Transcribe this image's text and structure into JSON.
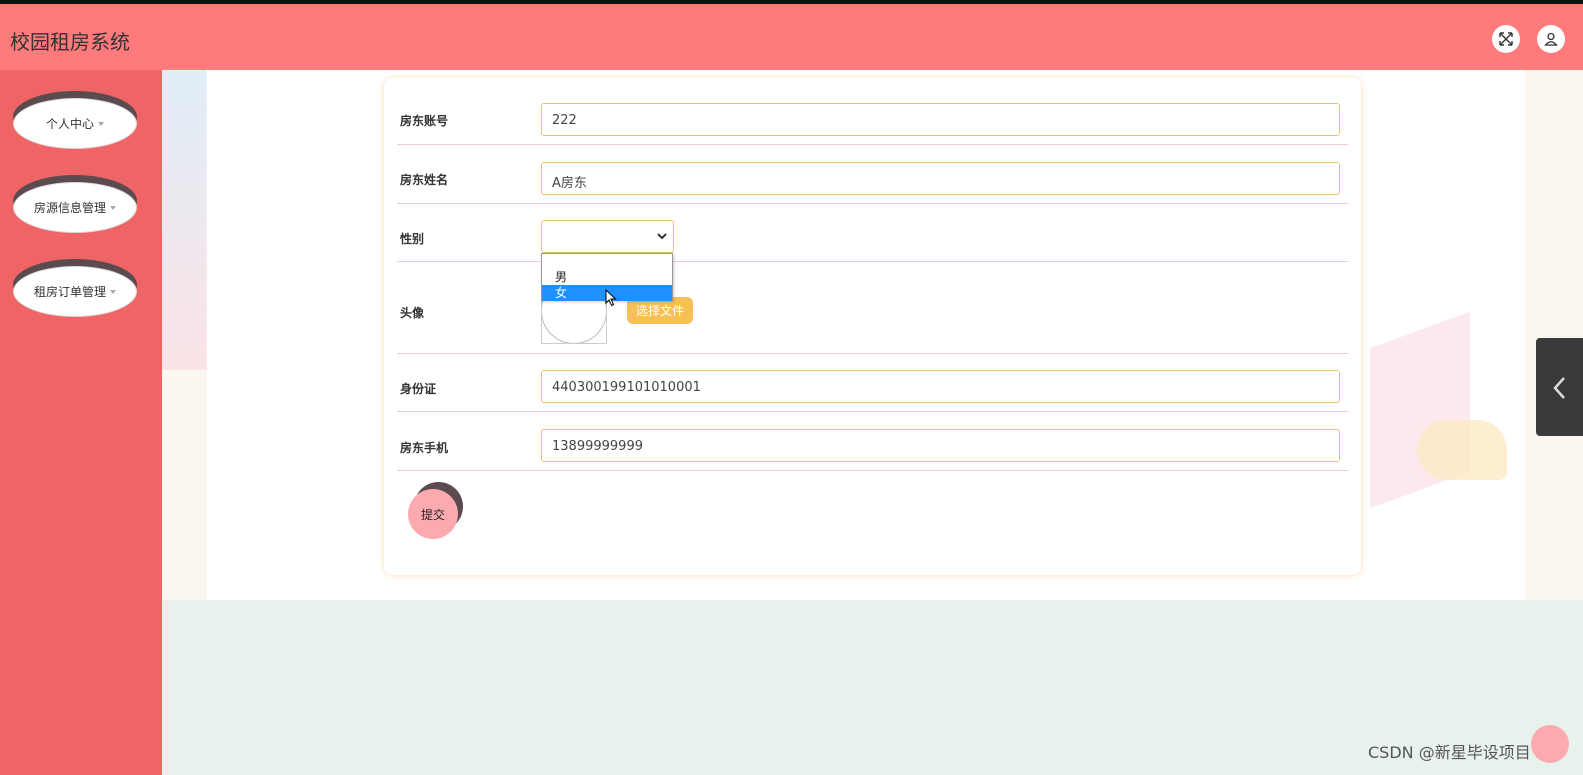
{
  "header": {
    "title": "校园租房系统",
    "fullscreen_icon": "fullscreen-icon",
    "user_icon": "user-icon",
    "background": "#fe7a7b"
  },
  "sidebar": {
    "background": "#ef6566",
    "items": [
      {
        "label": "个人中心"
      },
      {
        "label": "房源信息管理"
      },
      {
        "label": "租房订单管理"
      }
    ]
  },
  "form": {
    "landlord_account": {
      "label": "房东账号",
      "value": "222"
    },
    "landlord_name": {
      "label": "房东姓名",
      "value": "A房东"
    },
    "gender": {
      "label": "性别",
      "value": "",
      "options": [
        "男",
        "女"
      ],
      "highlighted": "女"
    },
    "avatar": {
      "label": "头像",
      "button_label": "选择文件"
    },
    "id_card": {
      "label": "身份证",
      "value": "440300199101010001"
    },
    "phone": {
      "label": "房东手机",
      "value": "13899999999"
    },
    "submit_label": "提交"
  },
  "watermark": "CSDN @新星毕设项目"
}
